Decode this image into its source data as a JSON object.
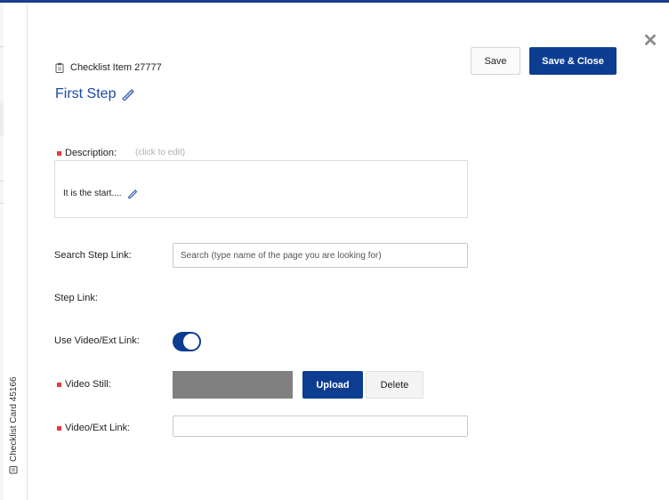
{
  "rail": {
    "label": "Checklist Card 45166"
  },
  "header": {
    "item_label": "Checklist Item 27777",
    "title": "First Step",
    "save_label": "Save",
    "save_close_label": "Save & Close",
    "close_glyph": "✕"
  },
  "form": {
    "description": {
      "label": "Description:",
      "hint": "(click to edit)",
      "value": "It is the start...."
    },
    "search_step_link": {
      "label": "Search Step Link:",
      "placeholder": "Search (type name of the page you are looking for)",
      "value": ""
    },
    "step_link": {
      "label": "Step Link:"
    },
    "use_video": {
      "label": "Use Video/Ext Link:",
      "enabled": true
    },
    "video_still": {
      "label": "Video Still:",
      "upload_label": "Upload",
      "delete_label": "Delete"
    },
    "video_ext_link": {
      "label": "Video/Ext Link:",
      "value": ""
    }
  },
  "colors": {
    "primary": "#0d3d91",
    "title": "#1a4aa6",
    "required": "#e8393f",
    "still_placeholder": "#808080"
  },
  "icons": [
    "clipboard-icon",
    "pencil-icon",
    "close-icon",
    "card-icon"
  ]
}
